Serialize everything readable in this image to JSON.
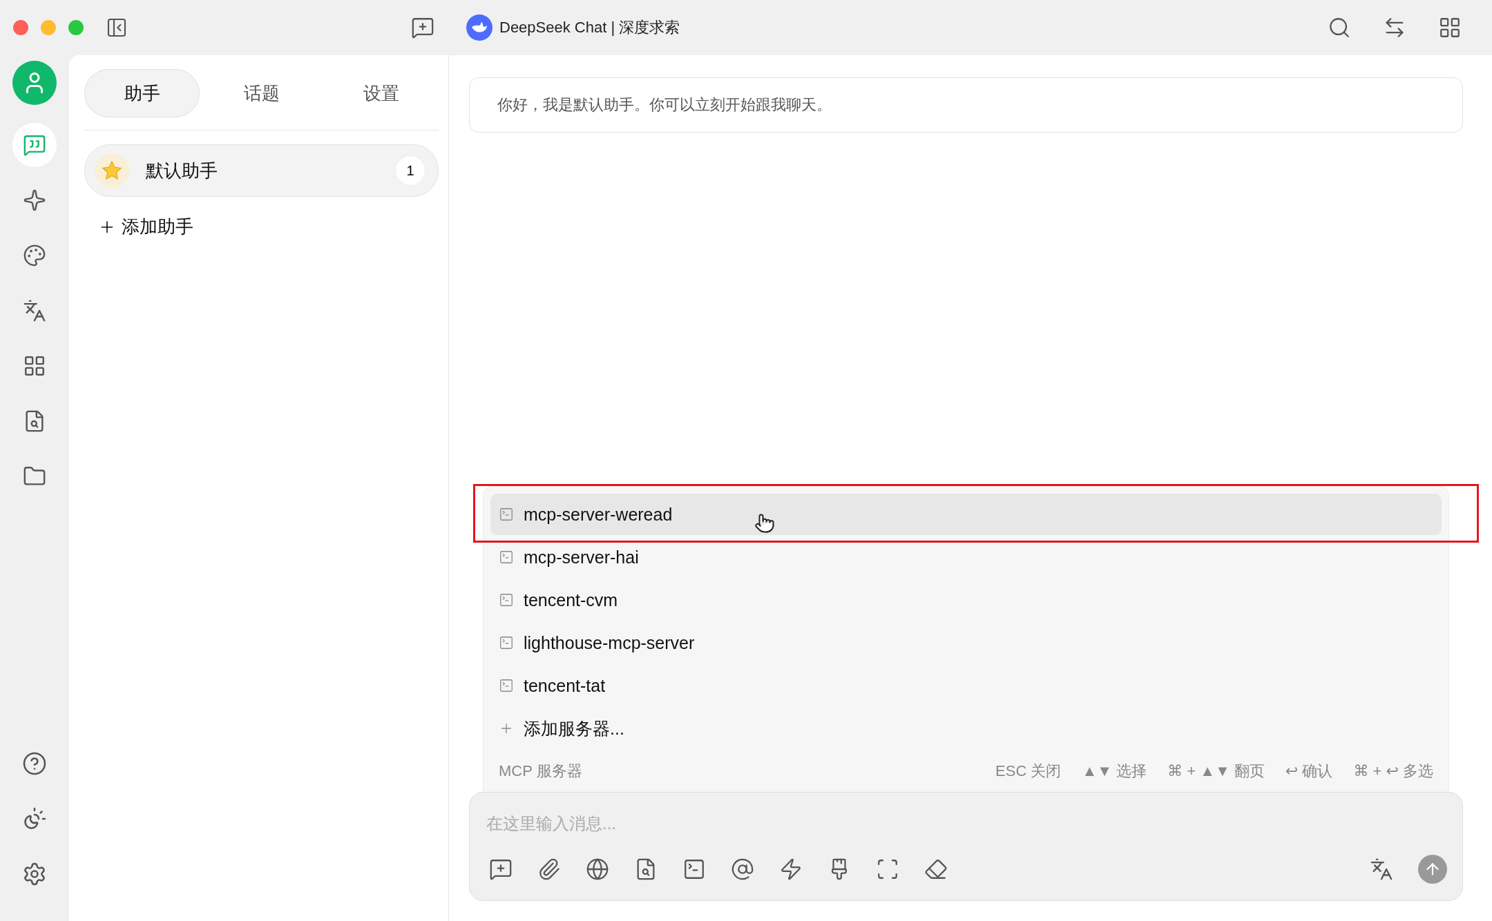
{
  "window": {
    "title": "DeepSeek Chat | 深度求索"
  },
  "rail": {
    "items": [
      {
        "kind": "chat",
        "selected": true
      },
      {
        "kind": "agents",
        "selected": false
      },
      {
        "kind": "paint",
        "selected": false
      },
      {
        "kind": "translate",
        "selected": false
      },
      {
        "kind": "apps",
        "selected": false
      },
      {
        "kind": "files",
        "selected": false
      },
      {
        "kind": "folder",
        "selected": false
      }
    ]
  },
  "tabs": [
    {
      "label": "助手",
      "selected": true
    },
    {
      "label": "话题",
      "selected": false
    },
    {
      "label": "设置",
      "selected": false
    }
  ],
  "assistants": [
    {
      "name": "默认助手",
      "count": "1",
      "selected": true
    }
  ],
  "add_assistant": "添加助手",
  "greeting": "你好，我是默认助手。你可以立刻开始跟我聊天。",
  "mcp_menu": {
    "items": [
      {
        "label": "mcp-server-weread",
        "selected": true,
        "annotated": true
      },
      {
        "label": "mcp-server-hai",
        "selected": false,
        "annotated": false
      },
      {
        "label": "tencent-cvm",
        "selected": false,
        "annotated": false
      },
      {
        "label": "lighthouse-mcp-server",
        "selected": false,
        "annotated": false
      },
      {
        "label": "tencent-tat",
        "selected": false,
        "annotated": false
      }
    ],
    "add_label": "添加服务器...",
    "footer_title": "MCP 服务器",
    "hints": [
      "ESC 关闭",
      "▲▼ 选择",
      "⌘ + ▲▼ 翻页",
      "↩ 确认",
      "⌘ + ↩ 多选"
    ]
  },
  "input": {
    "placeholder": "在这里输入消息..."
  }
}
